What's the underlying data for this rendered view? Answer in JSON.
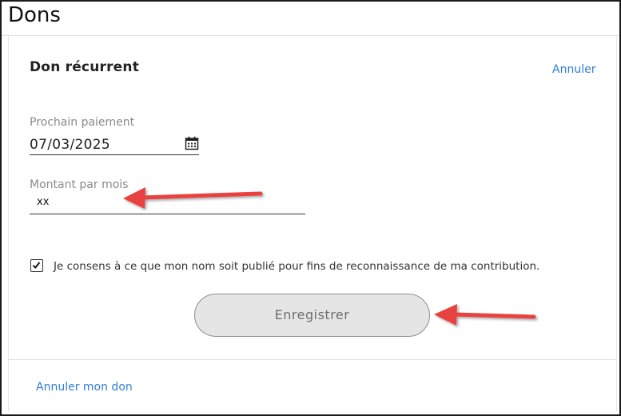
{
  "page": {
    "title": "Dons"
  },
  "card": {
    "title": "Don récurrent",
    "cancel_link": "Annuler"
  },
  "next_payment": {
    "label": "Prochain paiement",
    "value": "07/03/2025",
    "icon": "calendar-icon"
  },
  "monthly_amount": {
    "label": "Montant par mois",
    "value": "xx"
  },
  "consent": {
    "checked": true,
    "text": "Je consens à ce que mon nom soit publié pour fins de reconnaissance de ma contribution."
  },
  "actions": {
    "save_label": "Enregistrer",
    "cancel_donation_label": "Annuler mon don"
  },
  "colors": {
    "link": "#2f7ed8",
    "annotation_arrow": "#e8423f",
    "button_bg": "#e5e5e5"
  }
}
